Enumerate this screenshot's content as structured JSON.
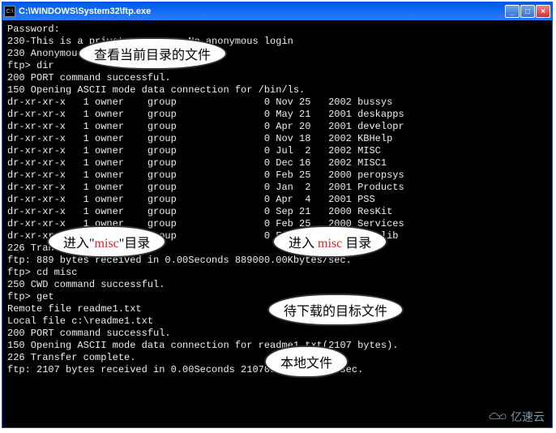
{
  "title_bar": {
    "icon_glyph": "C:\\",
    "title": "C:\\WINDOWS\\System32\\ftp.exe",
    "min": "_",
    "max": "□",
    "close": "×"
  },
  "terminal": {
    "lines": [
      "Password:",
      "230-This is a private system - No anonymous login",
      "230 Anonymous user logged in.",
      "ftp> dir",
      "200 PORT command successful.",
      "150 Opening ASCII mode data connection for /bin/ls.",
      "dr-xr-xr-x   1 owner    group               0 Nov 25   2002 bussys",
      "dr-xr-xr-x   1 owner    group               0 May 21   2001 deskapps",
      "dr-xr-xr-x   1 owner    group               0 Apr 20   2001 developr",
      "dr-xr-xr-x   1 owner    group               0 Nov 18   2002 KBHelp",
      "dr-xr-xr-x   1 owner    group               0 Jul  2   2002 MISC",
      "dr-xr-xr-x   1 owner    group               0 Dec 16   2002 MISC1",
      "dr-xr-xr-x   1 owner    group               0 Feb 25   2000 peropsys",
      "dr-xr-xr-x   1 owner    group               0 Jan  2   2001 Products",
      "dr-xr-xr-x   1 owner    group               0 Apr  4   2001 PSS",
      "dr-xr-xr-x   1 owner    group               0 Sep 21   2000 ResKit",
      "dr-xr-xr-x   1 owner    group               0 Feb 25   2000 Services",
      "dr-xr-xr-x   1 owner    group               0 Feb 25   2000 Softlib",
      "226 Transfer complete.",
      "ftp: 889 bytes received in 0.00Seconds 889000.00Kbytes/sec.",
      "ftp> cd misc",
      "250 CWD command successful.",
      "ftp> get",
      "Remote file readme1.txt",
      "Local file c:\\readme1.txt",
      "200 PORT command successful.",
      "150 Opening ASCII mode data connection for readme1.txt(2107 bytes).",
      "226 Transfer complete.",
      "ftp: 2107 bytes received in 0.00Seconds 2107000.00Kbytes/sec."
    ]
  },
  "callouts": {
    "c1": "查看当前目录的文件",
    "c2_a": "进入\"",
    "c2_b": "misc",
    "c2_c": "\"目录",
    "c3_a": "进入",
    "c3_b": "misc",
    "c3_c": "目录",
    "c4": "待下载的目标文件",
    "c5": "本地文件"
  },
  "watermark": "亿速云"
}
